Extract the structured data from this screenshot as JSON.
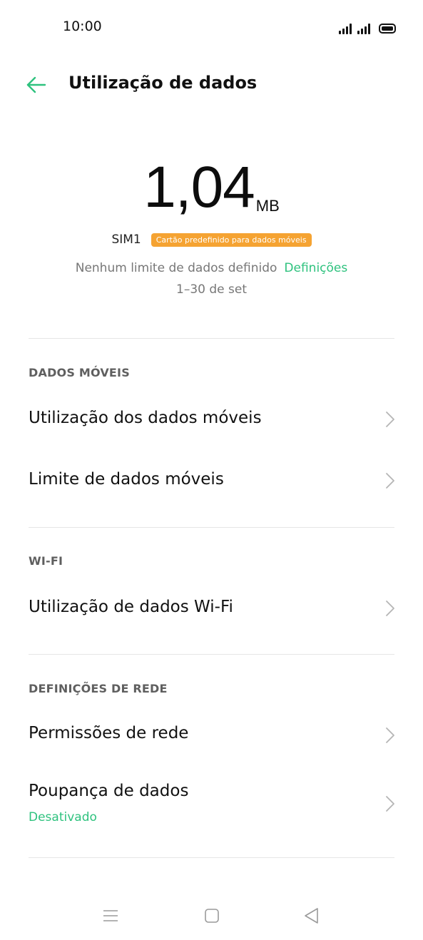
{
  "status_bar": {
    "time": "10:00",
    "icons": [
      "signal-icon",
      "signal-icon",
      "battery-icon"
    ]
  },
  "header": {
    "back_icon": "arrow-left-icon",
    "title": "Utilização de dados"
  },
  "usage": {
    "value": "1,04",
    "unit": "MB",
    "sim_label": "SIM1",
    "sim_badge": "Cartão predefinido para dados móveis",
    "limit_text": "Nenhum limite de dados definido",
    "limit_link": "Definições",
    "period": "1–30 de set"
  },
  "sections": {
    "mobile": {
      "header": "DADOS MÓVEIS",
      "items": [
        {
          "label": "Utilização dos dados móveis"
        },
        {
          "label": "Limite de dados móveis"
        }
      ]
    },
    "wifi": {
      "header": "WI-FI",
      "items": [
        {
          "label": "Utilização de dados Wi-Fi"
        }
      ]
    },
    "network": {
      "header": "DEFINIÇÕES DE REDE",
      "items": [
        {
          "label": "Permissões de rede"
        },
        {
          "label": "Poupança de dados",
          "sub": "Desativado"
        }
      ]
    }
  },
  "colors": {
    "accent": "#2ec27e",
    "badge": "#f5a332",
    "text": "#111111",
    "secondary": "#777777"
  },
  "nav_bar": {
    "icons": [
      "menu-icon",
      "home-icon",
      "back-triangle-icon"
    ]
  }
}
